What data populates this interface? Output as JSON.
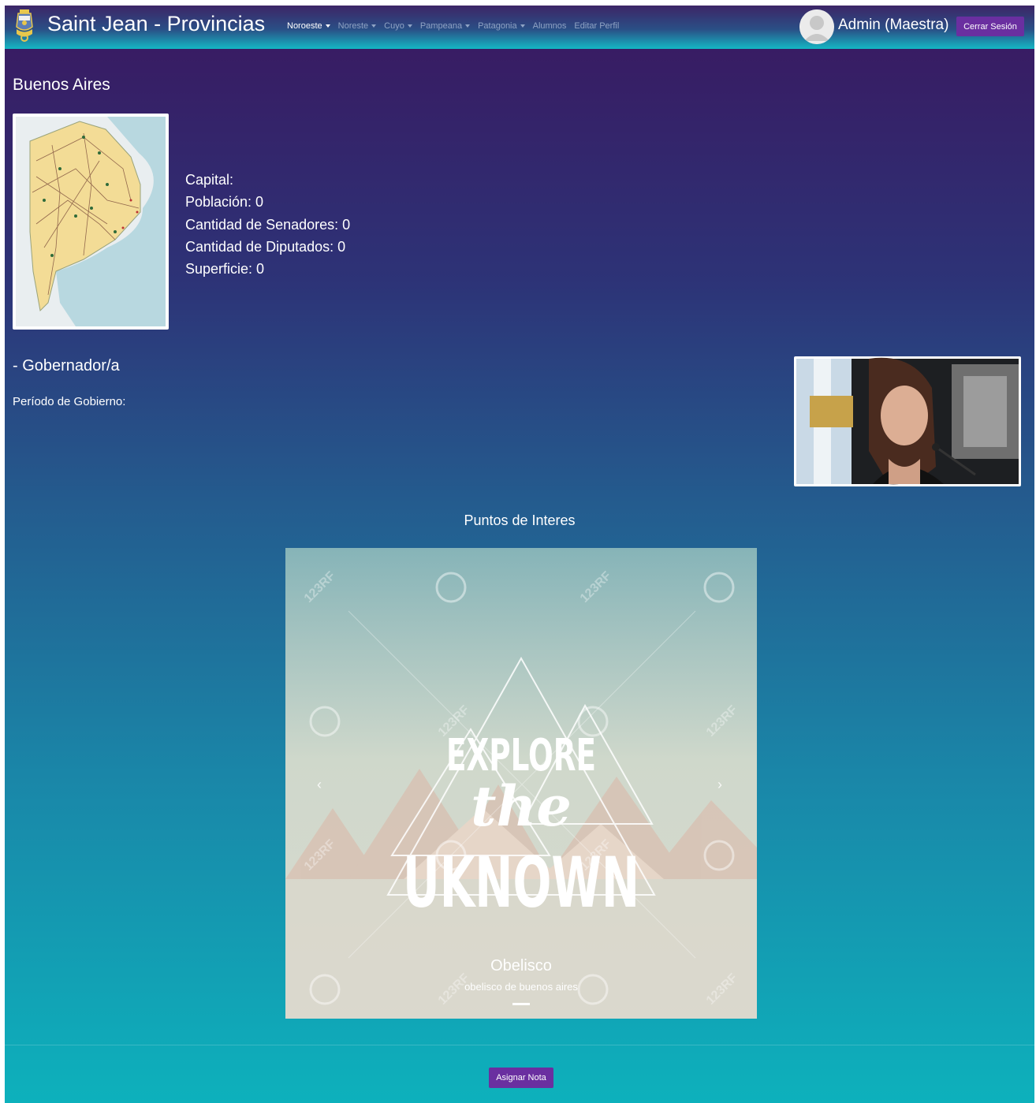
{
  "navbar": {
    "brand": "Saint Jean - Provincias",
    "menu": [
      {
        "label": "Noroeste",
        "dropdown": true,
        "active": true
      },
      {
        "label": "Noreste",
        "dropdown": true,
        "active": false
      },
      {
        "label": "Cuyo",
        "dropdown": true,
        "active": false
      },
      {
        "label": "Pampeana",
        "dropdown": true,
        "active": false
      },
      {
        "label": "Patagonia",
        "dropdown": true,
        "active": false
      },
      {
        "label": "Alumnos",
        "dropdown": false,
        "active": false
      },
      {
        "label": "Editar Perfil",
        "dropdown": false,
        "active": false
      }
    ],
    "user": "Admin (Maestra)",
    "logout": "Cerrar Sesión"
  },
  "province": {
    "name": "Buenos Aires",
    "capital": "Capital:",
    "population": "Población: 0",
    "senators": "Cantidad de Senadores: 0",
    "deputies": "Cantidad de Diputados: 0",
    "surface": "Superficie: 0"
  },
  "governor": {
    "title": "- Gobernador/a",
    "period": "Período de Gobierno:"
  },
  "points": {
    "title": "Puntos de Interes",
    "slide_title": "Obelisco",
    "slide_subtitle": "obelisco de buenos aires",
    "image_text": [
      "EXPLORE",
      "the",
      "UKNOWN"
    ],
    "watermark": "123RF"
  },
  "actions": {
    "assign_grade": "Asignar Nota"
  },
  "colors": {
    "accent_button": "#6a2fa0",
    "gradient_top": "#3a1860",
    "gradient_bottom": "#0db1bc"
  },
  "icons": {
    "logo": "coat-of-arms-icon",
    "avatar": "user-avatar-icon",
    "prev": "chevron-left-icon",
    "next": "chevron-right-icon"
  }
}
